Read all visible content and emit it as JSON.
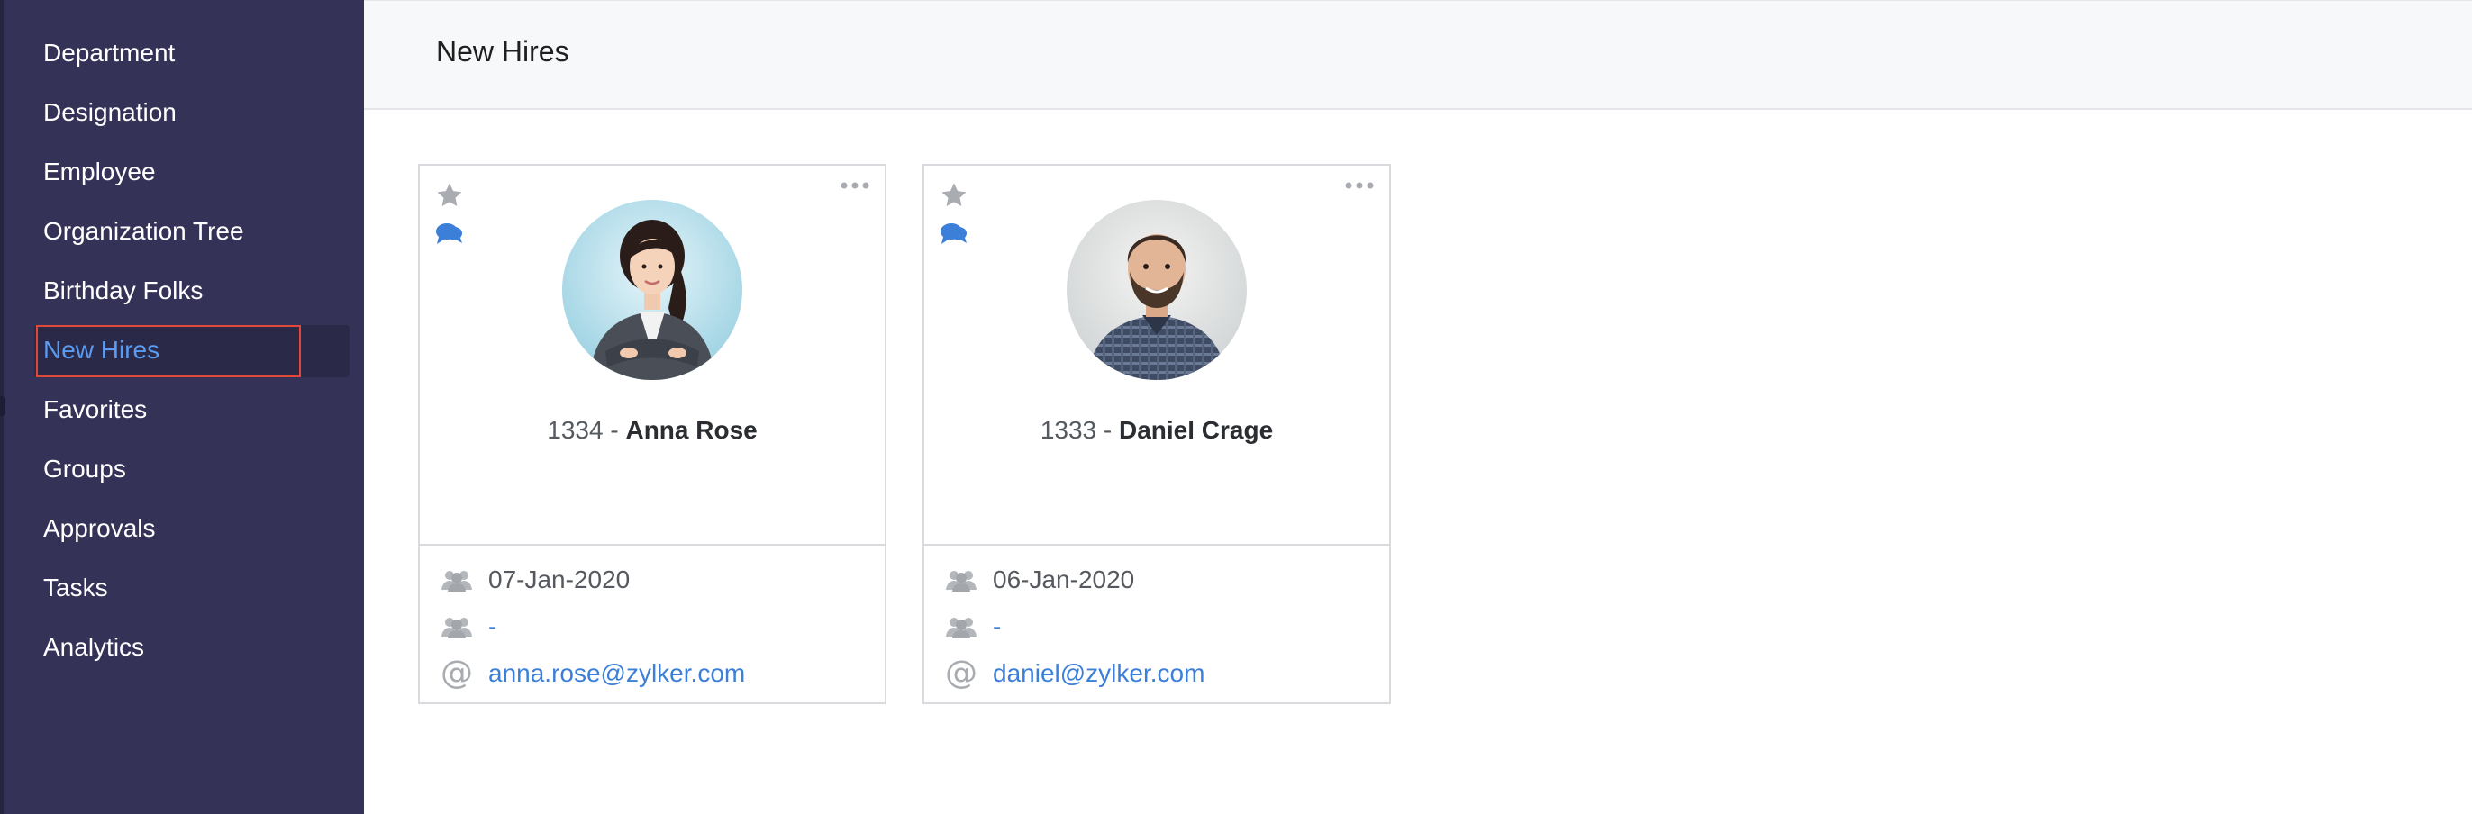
{
  "sidebar": {
    "items": [
      {
        "label": "Department"
      },
      {
        "label": "Designation"
      },
      {
        "label": "Employee"
      },
      {
        "label": "Organization Tree"
      },
      {
        "label": "Birthday Folks"
      },
      {
        "label": "New Hires",
        "active": true
      },
      {
        "label": "Favorites"
      },
      {
        "label": "Groups"
      },
      {
        "label": "Approvals"
      },
      {
        "label": "Tasks"
      },
      {
        "label": "Analytics"
      }
    ]
  },
  "header": {
    "title": "New Hires"
  },
  "cards": [
    {
      "id": "1334",
      "sep": " - ",
      "name": "Anna Rose",
      "joined": "07-Jan-2020",
      "group": "-",
      "email": "anna.rose@zylker.com"
    },
    {
      "id": "1333",
      "sep": " - ",
      "name": "Daniel Crage",
      "joined": "06-Jan-2020",
      "group": "-",
      "email": "daniel@zylker.com"
    }
  ],
  "colors": {
    "sidebar_bg": "#353258",
    "active_text": "#5b9bf0",
    "highlight_border": "#e0483a",
    "link": "#3c7fd8"
  },
  "icons": {
    "star": "star-icon",
    "chat": "chat-icon",
    "more": "more-icon",
    "group": "group-icon",
    "email": "at-icon"
  }
}
